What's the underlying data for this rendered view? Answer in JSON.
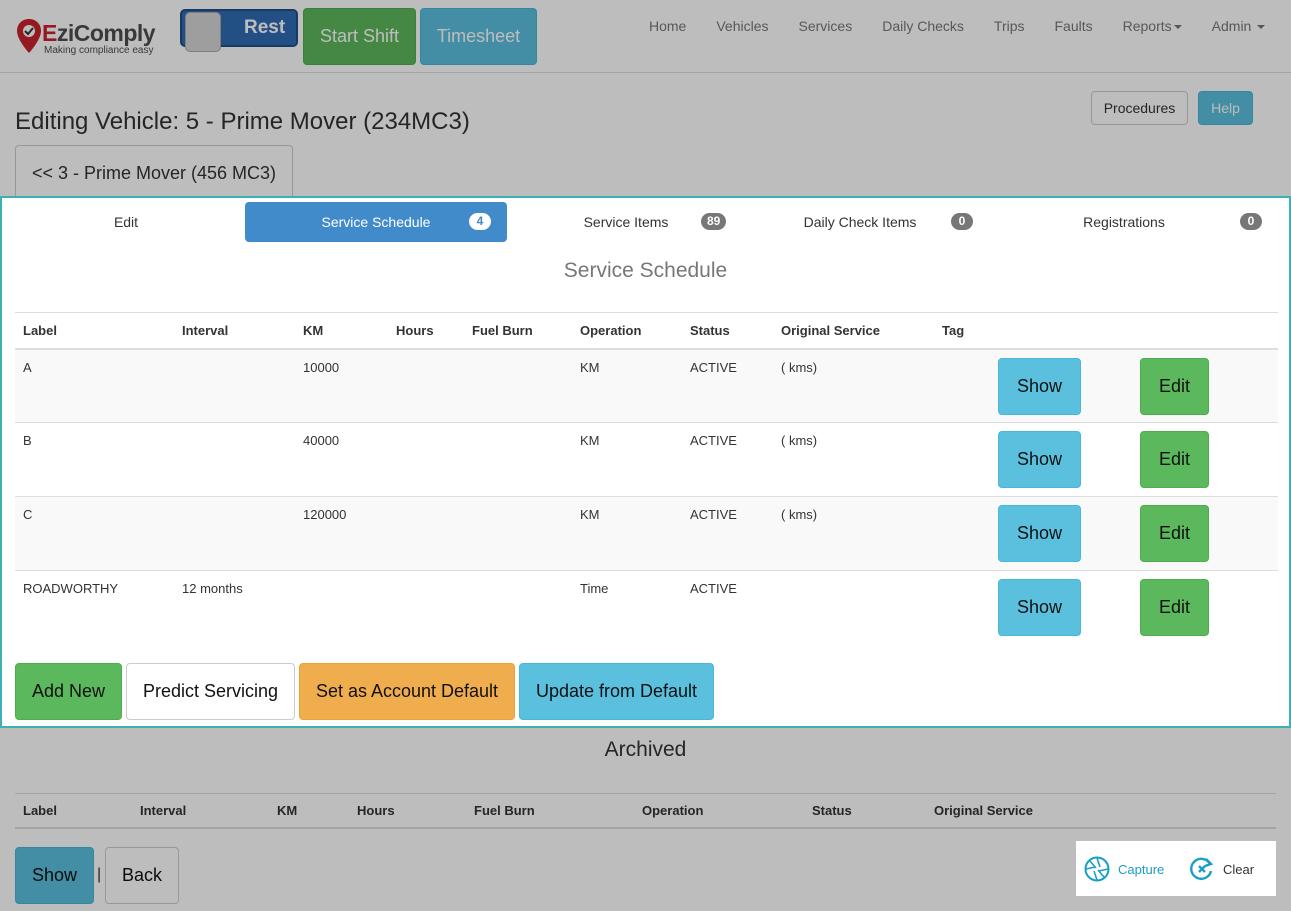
{
  "brand": {
    "name_e": "E",
    "name_rest": "ziComply",
    "tagline": "Making compliance easy"
  },
  "header": {
    "toggle_label": "Rest",
    "start_shift": "Start Shift",
    "timesheet": "Timesheet",
    "menu": [
      "Home",
      "Vehicles",
      "Services",
      "Daily Checks",
      "Trips",
      "Faults",
      "Reports",
      "Admin"
    ]
  },
  "page": {
    "title": "Editing Vehicle: 5 - Prime Mover (234MC3)",
    "procedures": "Procedures",
    "help": "Help",
    "prev_vehicle": "<< 3 - Prime Mover (456 MC3)"
  },
  "tabs": [
    {
      "label": "Edit",
      "badge": ""
    },
    {
      "label": "Service Schedule",
      "badge": "4"
    },
    {
      "label": "Service Items",
      "badge": "89"
    },
    {
      "label": "Daily Check Items",
      "badge": "0"
    },
    {
      "label": "Registrations",
      "badge": "0"
    }
  ],
  "schedule": {
    "title": "Service Schedule",
    "columns": [
      "Label",
      "Interval",
      "KM",
      "Hours",
      "Fuel Burn",
      "Operation",
      "Status",
      "Original Service",
      "Tag"
    ],
    "rows": [
      {
        "label": "A",
        "interval": "",
        "km": "10000",
        "hours": "",
        "fuel": "",
        "operation": "KM",
        "status": "ACTIVE",
        "original": "( kms)",
        "tag": ""
      },
      {
        "label": "B",
        "interval": "",
        "km": "40000",
        "hours": "",
        "fuel": "",
        "operation": "KM",
        "status": "ACTIVE",
        "original": "( kms)",
        "tag": ""
      },
      {
        "label": "C",
        "interval": "",
        "km": "120000",
        "hours": "",
        "fuel": "",
        "operation": "KM",
        "status": "ACTIVE",
        "original": "( kms)",
        "tag": ""
      },
      {
        "label": "ROADWORTHY",
        "interval": "12 months",
        "km": "",
        "hours": "",
        "fuel": "",
        "operation": "Time",
        "status": "ACTIVE",
        "original": "",
        "tag": ""
      }
    ],
    "show_label": "Show",
    "edit_label": "Edit",
    "actions": {
      "add_new": "Add New",
      "predict": "Predict Servicing",
      "set_default": "Set as Account Default",
      "update_default": "Update from Default"
    }
  },
  "archived": {
    "title": "Archived",
    "columns": [
      "Label",
      "Interval",
      "KM",
      "Hours",
      "Fuel Burn",
      "Operation",
      "Status",
      "Original Service"
    ],
    "show": "Show",
    "separator": "|",
    "back": "Back"
  },
  "capture": {
    "capture_label": "Capture",
    "clear_label": "Clear"
  },
  "colors": {
    "primary": "#428bca",
    "info": "#5bc0de",
    "success": "#5cb85c",
    "warning": "#f0ad4e",
    "highlight": "#3bb0b5"
  }
}
